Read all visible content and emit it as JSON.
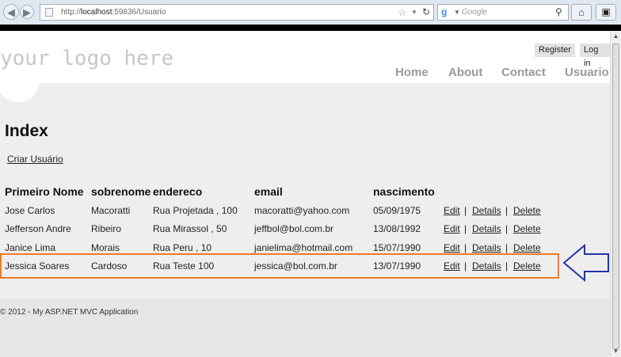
{
  "browser": {
    "url_prefix": "http://",
    "url_host": "localhost",
    "url_rest": ":59836/Usuario",
    "search_placeholder": "Google"
  },
  "site": {
    "logo": "your logo here",
    "register": "Register",
    "login": "Log in",
    "menu": [
      "Home",
      "About",
      "Contact",
      "Usuario"
    ],
    "footer": "© 2012 - My ASP.NET MVC Application"
  },
  "page": {
    "title": "Index",
    "create_link": "Criar Usuário"
  },
  "table": {
    "headers": [
      "Primeiro Nome",
      "sobrenome",
      "endereco",
      "email",
      "nascimento"
    ],
    "rows": [
      {
        "nome": "Jose Carlos",
        "sobrenome": "Macoratti",
        "endereco": "Rua Projetada , 100",
        "email": "macoratti@yahoo.com",
        "nascimento": "05/09/1975"
      },
      {
        "nome": "Jefferson Andre",
        "sobrenome": "Ribeiro",
        "endereco": "Rua Mirassol , 50",
        "email": "jeffbol@bol.com.br",
        "nascimento": "13/08/1992"
      },
      {
        "nome": "Janice Lima",
        "sobrenome": "Morais",
        "endereco": "Rua Peru , 10",
        "email": "janielima@hotmail.com",
        "nascimento": "15/07/1990"
      },
      {
        "nome": "Jessica Soares",
        "sobrenome": "Cardoso",
        "endereco": "Rua Teste 100",
        "email": "jessica@bol.com.br",
        "nascimento": "13/07/1990"
      }
    ],
    "actions": {
      "edit": "Edit",
      "details": "Details",
      "delete": "Delete",
      "separator": "|"
    }
  },
  "colors": {
    "highlight": "#f17b24",
    "arrow": "#2233aa"
  }
}
